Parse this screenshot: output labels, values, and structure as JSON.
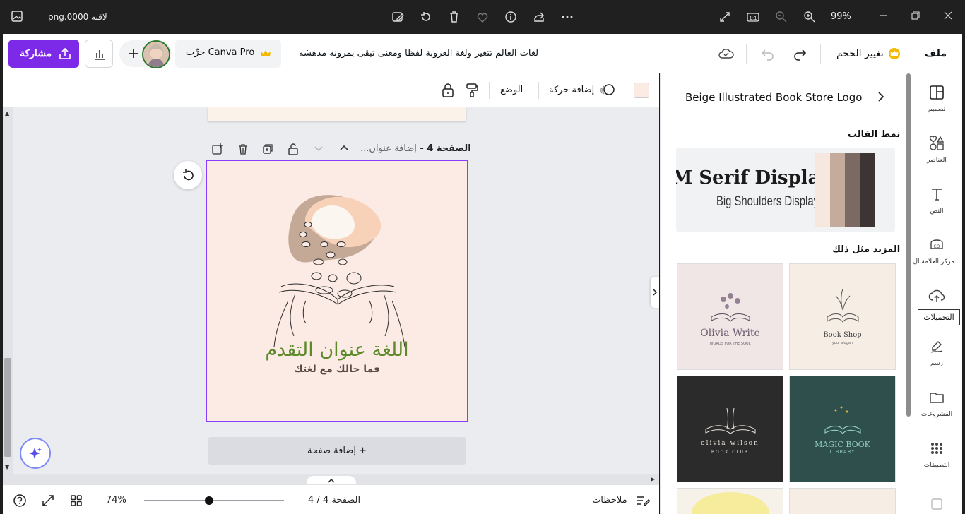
{
  "viewer": {
    "filename": "لاقتة 0000.png",
    "zoom": "99%"
  },
  "topbar": {
    "menu_file": "ملف",
    "resize": "تغيير الحجم",
    "doc_title": "لغات العالم تتغير ولغة العروبة لفظا ومعنى تبقى بمرونه مدهشه",
    "try_pro": "جرِّب Canva Pro",
    "share": "مشاركة"
  },
  "context_toolbar": {
    "position": "الوضع",
    "animate": "إضافة حركة"
  },
  "page": {
    "header": "الصفحة 4 - ",
    "title_placeholder": "إضافة عنوان...",
    "design_title": "اللغة عنوان التقدم",
    "design_subtitle": "فما حالك مع لغتك",
    "add_page": "+ إضافة صفحة"
  },
  "bottombar": {
    "notes": "ملاحظات",
    "page_indicator": "الصفحة 4 / 4",
    "zoom": "74%",
    "zoom_value": 0.74
  },
  "panel": {
    "template_name": "Beige Illustrated Book Store Logo",
    "style_heading": "نمط القالب",
    "font_primary": "DM Serif Display",
    "font_secondary": "Big Shoulders Display",
    "more_heading": "المزيد مثل ذلك",
    "palette": [
      "#f6e7df",
      "#c4ab9b",
      "#7a6a63",
      "#3d3533"
    ],
    "thumbs": [
      {
        "name": "Olivia Write",
        "sub": "WORDS FOR THE SOUL",
        "bg": "#f1e6e6",
        "fg": "#6f5b6e"
      },
      {
        "name": "Book Shop",
        "sub": "your slogan",
        "bg": "#f6eee5",
        "fg": "#4a4a4a"
      },
      {
        "name": "olivia wilson",
        "sub": "BOOK CLUB",
        "bg": "#2b2b2b",
        "fg": "#e6e0d8"
      },
      {
        "name": "MAGIC BOOK",
        "sub": "LIBRARY",
        "bg": "#2f4f4c",
        "fg": "#8fc7c1"
      }
    ]
  },
  "sidebar": {
    "items": [
      {
        "label": "تصميم",
        "icon": "layout-icon"
      },
      {
        "label": "العناصر",
        "icon": "shapes-icon"
      },
      {
        "label": "النص",
        "icon": "text-icon"
      },
      {
        "label": "مركز العلامة ال...",
        "icon": "brand-icon"
      },
      {
        "label": "التحميلات",
        "icon": "upload-icon"
      },
      {
        "label": "رسم",
        "icon": "draw-icon"
      },
      {
        "label": "المشروعات",
        "icon": "folder-icon"
      },
      {
        "label": "التطبيقات",
        "icon": "apps-icon"
      }
    ],
    "tooltip": "التحميلات"
  },
  "colors": {
    "accent": "#7d2ae8",
    "canvas_bg": "#fbebe4",
    "design_title": "#5c8a2a",
    "design_subtitle": "#5a4a44"
  }
}
